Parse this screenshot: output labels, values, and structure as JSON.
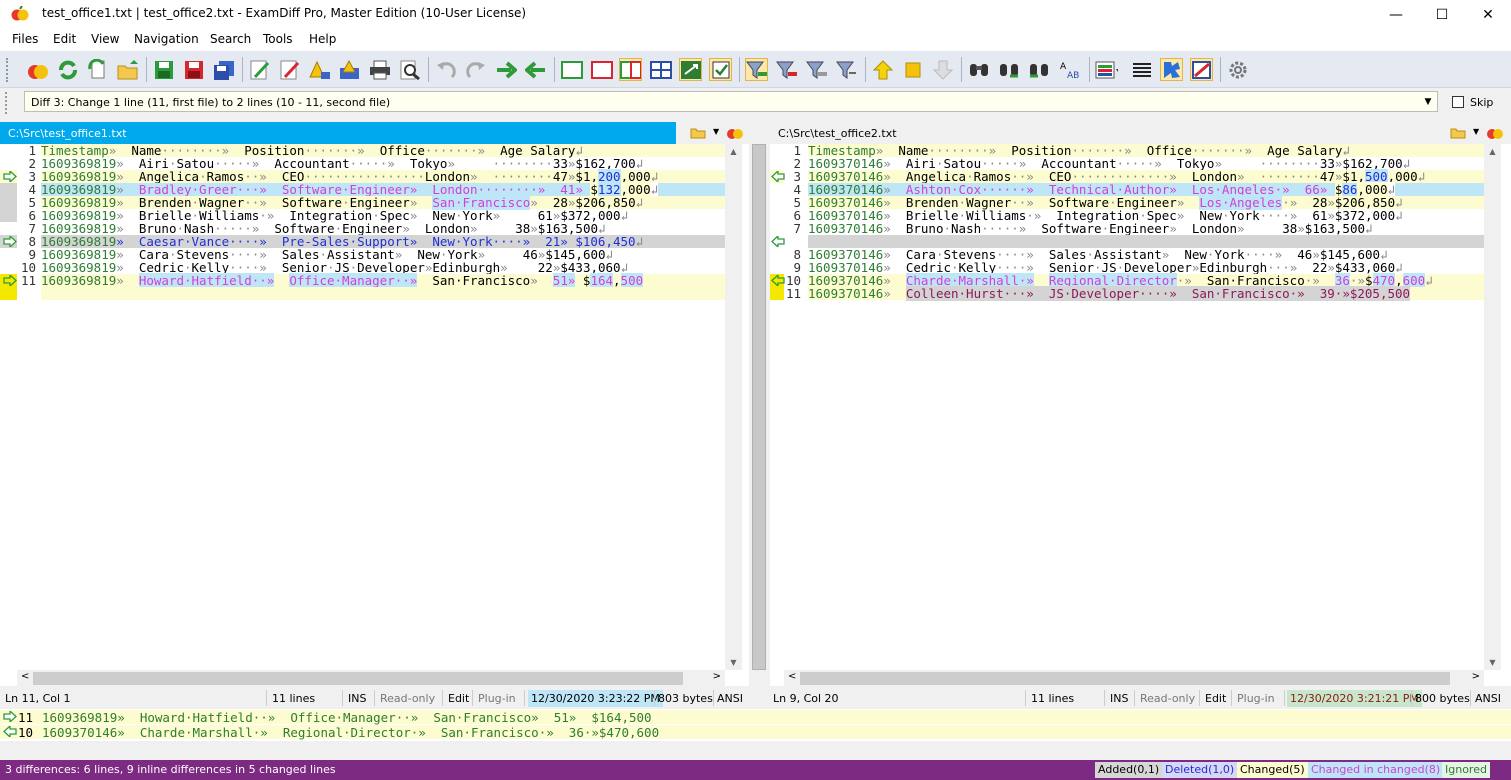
{
  "window": {
    "title": "test_office1.txt  |  test_office2.txt - ExamDiff Pro, Master Edition (10-User License)",
    "minimize": "—",
    "maximize": "☐",
    "close": "✕"
  },
  "menu": [
    "Files",
    "Edit",
    "View",
    "Navigation",
    "Search",
    "Tools",
    "Help"
  ],
  "diffbar": {
    "text": "Diff 3: Change 1 line (11, first file) to 2 lines (10 - 11, second file)",
    "skip_label": "Skip"
  },
  "left": {
    "path": "C:\\Src\\test_office1.txt",
    "line_numbers": [
      "1",
      "2",
      "3",
      "4",
      "5",
      "6",
      "7",
      "8",
      "9",
      "10",
      "11"
    ],
    "status": {
      "pos": "Ln 11, Col 1",
      "lines": "11 lines",
      "ins": "INS",
      "readonly": "Read-only",
      "edit": "Edit",
      "plugin": "Plug-in",
      "date": "12/30/2020 3:23:22 PM",
      "bytes": "803 bytes",
      "enc": "ANSI"
    }
  },
  "right": {
    "path": "C:\\Src\\test_office2.txt",
    "line_numbers": [
      "1",
      "2",
      "3",
      "4",
      "5",
      "6",
      "7",
      "",
      "8",
      "9",
      "10",
      "11"
    ],
    "status": {
      "pos": "Ln 9, Col 20",
      "lines": "11 lines",
      "ins": "INS",
      "readonly": "Read-only",
      "edit": "Edit",
      "plugin": "Plug-in",
      "date": "12/30/2020 3:21:21 PM",
      "bytes": "800 bytes",
      "enc": "ANSI"
    }
  },
  "bottom": {
    "line1_num": "11",
    "line1": "1609369819»  Howard·Hatfield··»  Office·Manager··»  San·Francisco»  51»  $164,500",
    "line2_num": "10",
    "line2": "1609370146»  Charde·Marshall·»  Regional·Director·»  San·Francisco·»  36·»$470,600"
  },
  "status": {
    "summary": "3 differences: 6 lines, 9 inline differences in 5 changed lines",
    "added": "Added(0,1)",
    "deleted": "Deleted(1,0)",
    "changed": "Changed(5)",
    "changed_in_changed": "Changed in changed(8)",
    "ignored": "Ignored"
  },
  "colors": {
    "accent_blue": "#00a8ec",
    "status_purple": "#7d2a83",
    "changed_yellow": "#fdfcd0",
    "changed_blue": "#bfe6f7"
  }
}
